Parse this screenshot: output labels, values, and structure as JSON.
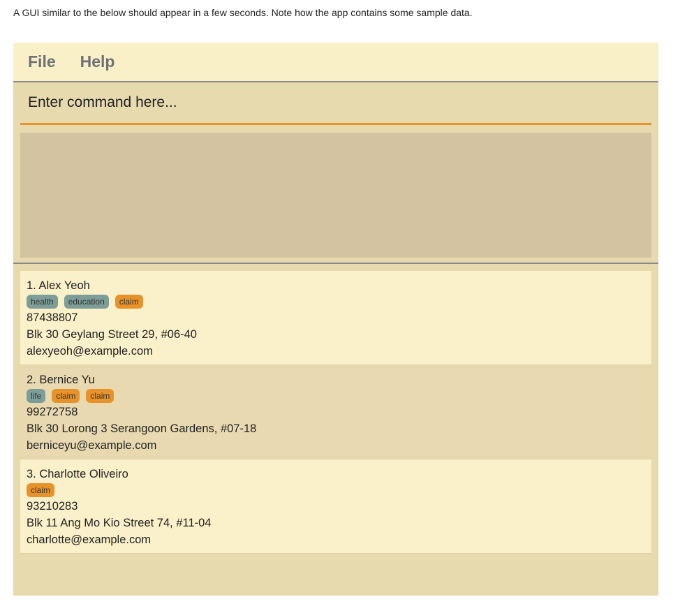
{
  "caption": "A GUI similar to the below should appear in a few seconds. Note how the app contains some sample data.",
  "menu": {
    "file": "File",
    "help": "Help"
  },
  "command": {
    "placeholder": "Enter command here..."
  },
  "persons": [
    {
      "name": "1. Alex Yeoh",
      "tags": [
        {
          "label": "health",
          "color": "teal"
        },
        {
          "label": "education",
          "color": "teal"
        },
        {
          "label": "claim",
          "color": "orange"
        }
      ],
      "phone": "87438807",
      "address": "Blk 30 Geylang Street 29, #06-40",
      "email": "alexyeoh@example.com"
    },
    {
      "name": "2. Bernice Yu",
      "tags": [
        {
          "label": "life",
          "color": "teal"
        },
        {
          "label": "claim",
          "color": "orange"
        },
        {
          "label": "claim",
          "color": "orange"
        }
      ],
      "phone": "99272758",
      "address": "Blk 30 Lorong 3 Serangoon Gardens, #07-18",
      "email": "berniceyu@example.com"
    },
    {
      "name": "3. Charlotte Oliveiro",
      "tags": [
        {
          "label": "claim",
          "color": "orange"
        }
      ],
      "phone": "93210283",
      "address": "Blk 11 Ang Mo Kio Street 74, #11-04",
      "email": "charlotte@example.com"
    }
  ],
  "colors": {
    "teal": "#7d9e98",
    "orange": "#e8922a"
  }
}
